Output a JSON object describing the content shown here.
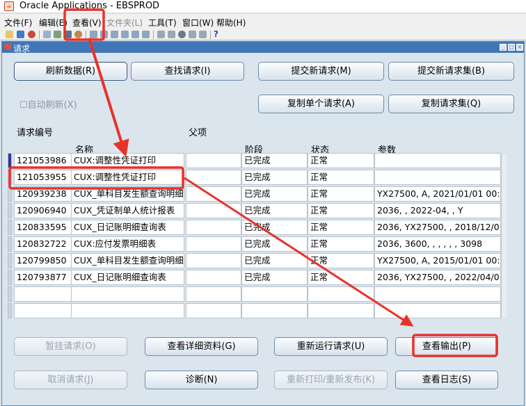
{
  "app": {
    "title": "Oracle Applications - EBSPROD"
  },
  "menu": {
    "items": [
      {
        "label": "文件(F)",
        "enabled": true
      },
      {
        "label": "编辑(E)",
        "enabled": true
      },
      {
        "label": "查看(V)",
        "enabled": true
      },
      {
        "label": "文件夹(L)",
        "enabled": false
      },
      {
        "label": "工具(T)",
        "enabled": true
      },
      {
        "label": "窗口(W)",
        "enabled": true
      },
      {
        "label": "帮助(H)",
        "enabled": true
      }
    ]
  },
  "toolbar": {
    "help_glyph": "?"
  },
  "window": {
    "title": "请求"
  },
  "top_buttons": {
    "refresh": "刷新数据(R)",
    "find": "查找请求(I)",
    "submit": "提交新请求(M)",
    "submit_set": "提交新请求集(B)",
    "copy_single": "复制单个请求(A)",
    "copy_set": "复制请求集(Q)"
  },
  "auto_refresh": {
    "label": "自动刷新(X)",
    "checked": false
  },
  "table": {
    "headers": {
      "request_id": "请求编号",
      "parent": "父项",
      "name": "名称",
      "phase": "阶段",
      "status": "状态",
      "params": "参数"
    },
    "rows": [
      {
        "id": "121053986",
        "name": "CUX:调整性凭证打印",
        "phase": "已完成",
        "status": "正常",
        "params": ""
      },
      {
        "id": "121053955",
        "name": "CUX:调整性凭证打印",
        "phase": "已完成",
        "status": "正常",
        "params": ""
      },
      {
        "id": "120939238",
        "name": "CUX_单科目发生额查询明细",
        "phase": "已完成",
        "status": "正常",
        "params": "YX27500, A, 2021/01/01 00:"
      },
      {
        "id": "120906940",
        "name": "CUX_凭证制单人统计报表",
        "phase": "已完成",
        "status": "正常",
        "params": "2036, , 2022-04, , Y"
      },
      {
        "id": "120833595",
        "name": "CUX_日记账明细查询表",
        "phase": "已完成",
        "status": "正常",
        "params": "2036, YX27500, , 2018/12/0"
      },
      {
        "id": "120832722",
        "name": "CUX:应付发票明细表",
        "phase": "已完成",
        "status": "正常",
        "params": "2036, 3600, , , , , , 3098"
      },
      {
        "id": "120799850",
        "name": "CUX_单科目发生额查询明细",
        "phase": "已完成",
        "status": "正常",
        "params": "YX27500, A, 2015/01/01 00:"
      },
      {
        "id": "120793877",
        "name": "CUX_日记账明细查询表",
        "phase": "已完成",
        "status": "正常",
        "params": "2036, YX27500, , 2022/04/0"
      },
      {
        "id": "",
        "name": "",
        "phase": "",
        "status": "",
        "params": ""
      },
      {
        "id": "",
        "name": "",
        "phase": "",
        "status": "",
        "params": ""
      }
    ]
  },
  "bottom_buttons": {
    "hold": "暂挂请求(O)",
    "details": "查看详细资料(G)",
    "rerun": "重新运行请求(U)",
    "output": "查看输出(P)",
    "cancel": "取消请求(J)",
    "diagnose": "诊断(N)",
    "reprint": "重新打印/重新发布(K)",
    "log": "查看日志(S)"
  },
  "annotation": {
    "color": "#e8322a"
  }
}
